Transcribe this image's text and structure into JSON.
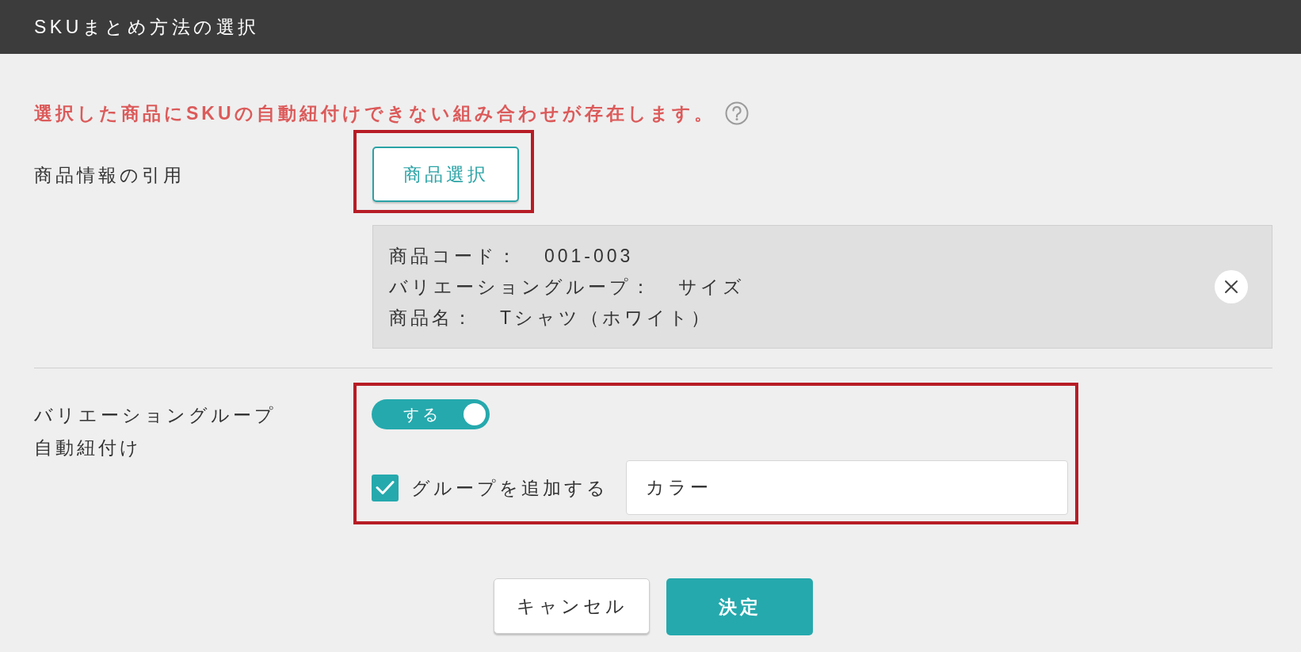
{
  "dialog": {
    "title": "SKUまとめ方法の選択"
  },
  "warning": {
    "text": "選択した商品にSKUの自動紐付けできない組み合わせが存在します。"
  },
  "product_source": {
    "label": "商品情報の引用",
    "highlighted": true,
    "button": "商品選択",
    "selected_product": [
      {
        "label": "商品コード：",
        "value": "001-003"
      },
      {
        "label": "バリエーショングループ：",
        "value": "サイズ"
      },
      {
        "label": "商品名：",
        "value": "Tシャツ（ホワイト）"
      }
    ]
  },
  "auto_link": {
    "label_lines": [
      "バリエーショングループ",
      "自動紐付け"
    ],
    "highlighted": true,
    "toggle": {
      "label": "する",
      "on": true
    },
    "add_group": {
      "label": "グループを追加する",
      "checked": true,
      "value": "カラー"
    }
  },
  "buttons": [
    {
      "label": "キャンセル",
      "kind": "secondary"
    },
    {
      "label": "決定",
      "kind": "primary"
    }
  ]
}
